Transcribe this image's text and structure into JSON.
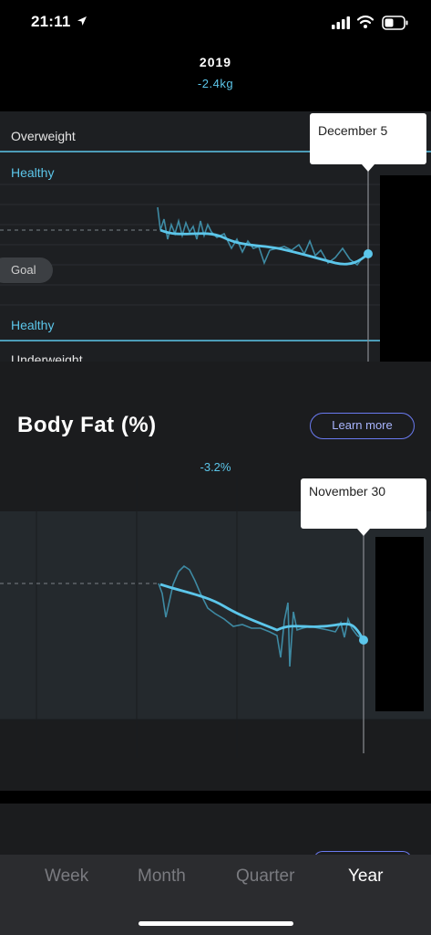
{
  "status_bar": {
    "time": "21:11"
  },
  "header": {
    "year": "2019",
    "delta": "-2.4kg"
  },
  "weight_chart": {
    "zones": {
      "overweight": "Overweight",
      "healthy_upper": "Healthy",
      "goal": "Goal",
      "healthy_lower": "Healthy",
      "underweight": "Underweight"
    },
    "tooltip": "December 5"
  },
  "body_fat": {
    "title": "Body Fat (%)",
    "learn_more": "Learn more",
    "delta": "-3.2%",
    "tooltip": "November 30"
  },
  "tabs": [
    {
      "label": "Week",
      "active": false
    },
    {
      "label": "Month",
      "active": false
    },
    {
      "label": "Quarter",
      "active": false
    },
    {
      "label": "Year",
      "active": true
    }
  ],
  "colors": {
    "accent": "#5cc6ea",
    "button_border": "#6a7af0",
    "panel": "#1d1f22"
  }
}
